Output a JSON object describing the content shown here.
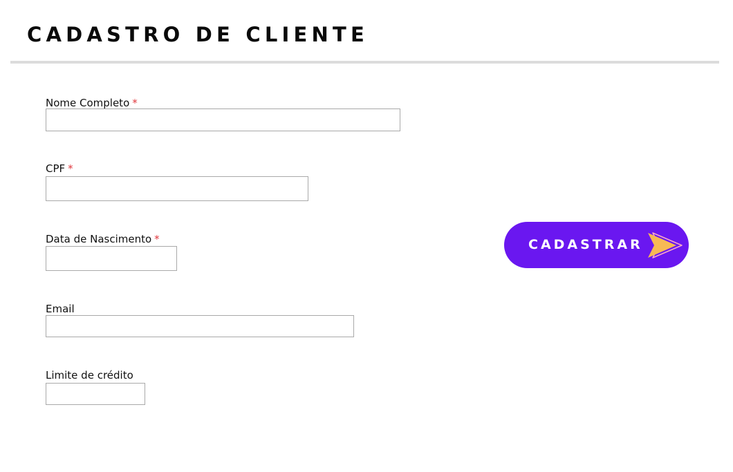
{
  "header": {
    "title": "CADASTRO DE CLIENTE"
  },
  "form": {
    "required_marker": "*",
    "fields": [
      {
        "label": "Nome Completo",
        "required": true,
        "value": ""
      },
      {
        "label": "CPF",
        "required": true,
        "value": ""
      },
      {
        "label": "Data de Nascimento",
        "required": true,
        "value": ""
      },
      {
        "label": "Email",
        "required": false,
        "value": ""
      },
      {
        "label": "Limite de crédito",
        "required": false,
        "value": ""
      }
    ],
    "submit": {
      "label": "CADASTRAR",
      "icon": "arrow-right-icon"
    }
  },
  "colors": {
    "accent": "#6a17f0",
    "required": "#e0383e",
    "arrow_fill": "#f7b955",
    "arrow_outline": "#f9a8c8"
  }
}
